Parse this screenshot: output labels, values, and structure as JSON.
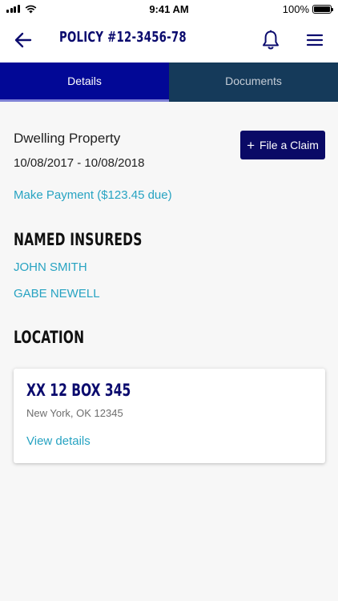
{
  "status_bar": {
    "time": "9:41 AM",
    "battery": "100%",
    "battery_level": 1.0,
    "icons": [
      "signal-icon",
      "wifi-icon",
      "battery-icon"
    ]
  },
  "nav": {
    "title": "POLICY #12-3456-78",
    "icons": [
      "back-arrow-icon",
      "bell-icon",
      "hamburger-menu-icon"
    ]
  },
  "tabs": [
    {
      "label": "Details",
      "active": true
    },
    {
      "label": "Documents",
      "active": false
    }
  ],
  "policy": {
    "type": "Dwelling Property",
    "dates": "10/08/2017 - 10/08/2018",
    "payment_link": "Make Payment ($123.45 due)",
    "file_claim": {
      "icon": "+",
      "label": "File a Claim"
    }
  },
  "named_insureds": {
    "heading": "NAMED INSUREDS",
    "names": [
      "JOHN SMITH",
      "GABE NEWELL"
    ]
  },
  "location": {
    "heading": "LOCATION",
    "address_line": "XX 12 BOX 345",
    "city_line": "New York, OK 12345",
    "details_link": "View details"
  },
  "colors": {
    "brand_navy": "#0a0a66",
    "tab_active": "#020896",
    "tab_inactive": "#153a5a",
    "link": "#27a3c2"
  }
}
